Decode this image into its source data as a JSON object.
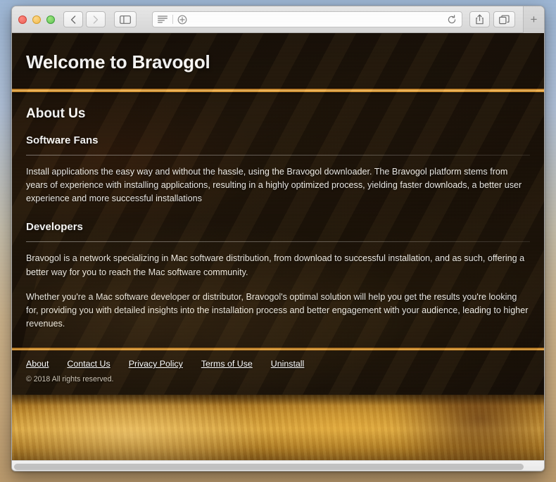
{
  "browser": {
    "traffic_lights": [
      "close",
      "minimize",
      "zoom"
    ],
    "nav": {
      "back_icon": "chevron-left-icon",
      "forward_icon": "chevron-right-icon",
      "sidebar_icon": "sidebar-toggle-icon"
    },
    "urlbar": {
      "reader_icon": "reader-view-icon",
      "zoom_icon": "zoom-in-icon",
      "value": "",
      "placeholder": "",
      "reload_icon": "reload-icon"
    },
    "right": {
      "share_icon": "share-icon",
      "tabs_icon": "show-tabs-icon",
      "new_tab_label": "+"
    }
  },
  "page": {
    "hero_title": "Welcome to Bravogol",
    "about": {
      "heading": "About Us",
      "subheading": "Software Fans",
      "paragraph": "Install applications the easy way and without the hassle, using the Bravogol downloader. The Bravogol platform stems from years of experience with installing applications, resulting in a highly optimized process, yielding faster downloads, a better user experience and more successful installations"
    },
    "developers": {
      "heading": "Developers",
      "paragraph_1": "Bravogol is a network specializing in Mac software distribution, from download to successful installation, and as such, offering a better way for you to reach the Mac software community.",
      "paragraph_2": "Whether you're a Mac software developer or distributor, Bravogol's optimal solution will help you get the results you're looking for, providing you with detailed insights into the installation process and better engagement with your audience, leading to higher revenues."
    },
    "footer": {
      "links": [
        {
          "label": "About"
        },
        {
          "label": "Contact Us"
        },
        {
          "label": "Privacy Policy"
        },
        {
          "label": "Terms of Use"
        },
        {
          "label": "Uninstall"
        }
      ],
      "copyright": "© 2018 All rights reserved."
    }
  },
  "colors": {
    "accent_orange": "#e8a53c",
    "page_dark": "#23170a",
    "text_light": "#f4f2ee",
    "band_gold": "#dca83f"
  }
}
